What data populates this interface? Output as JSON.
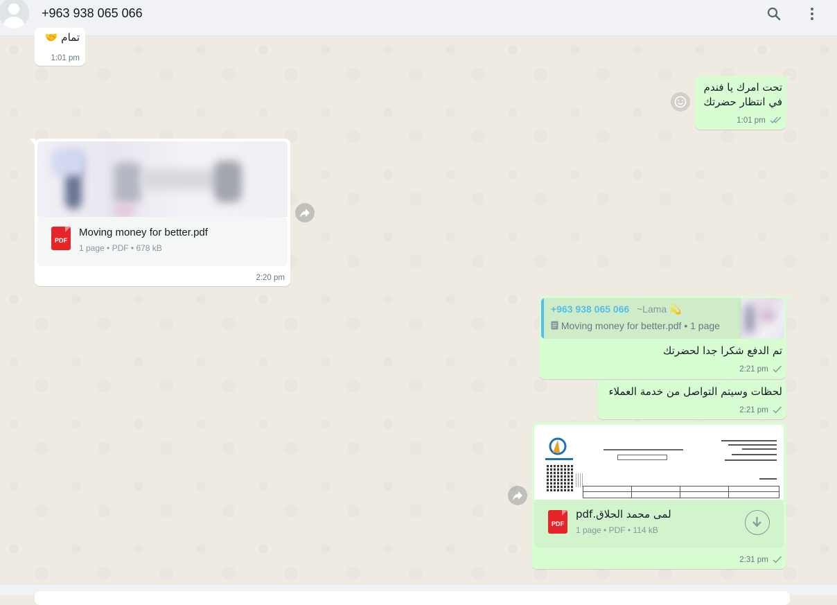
{
  "header": {
    "contact_name": "+963 938 065 066",
    "icons": [
      "search-icon",
      "menu-dots-icon"
    ]
  },
  "messages": [
    {
      "id": "m1",
      "direction": "incoming",
      "text": "تمام 🤝",
      "time": "1:01 pm"
    },
    {
      "id": "m2",
      "direction": "outgoing",
      "text_line1": "تحت امرك يا فندم",
      "text_line2": "في انتظار حضرتك",
      "time": "1:01 pm",
      "status": "read"
    },
    {
      "id": "m3",
      "direction": "incoming",
      "document": {
        "name": "Moving money for better.pdf",
        "icon_label": "PDF",
        "meta": [
          "1 page",
          "PDF",
          "678 kB"
        ]
      },
      "time": "2:20 pm"
    },
    {
      "id": "m4",
      "direction": "outgoing",
      "quote": {
        "sender": "+963 938 065 066",
        "sender_alias": "~Lama 💫",
        "text": "Moving money for better.pdf • 1 page"
      },
      "text": "تم الدفع شكرا جدا لحضرتك",
      "time": "2:21 pm",
      "status": "sent"
    },
    {
      "id": "m5",
      "direction": "outgoing",
      "text": "لحظات وسيتم التواصل من خدمة العملاء",
      "time": "2:21 pm",
      "status": "sent"
    },
    {
      "id": "m6",
      "direction": "outgoing",
      "document": {
        "name": "لمى محمد الحلاق.pdf",
        "icon_label": "PDF",
        "meta": [
          "1 page",
          "PDF",
          "114 kB"
        ]
      },
      "time": "2:31 pm",
      "status": "sent"
    }
  ],
  "colors": {
    "chat_bg": "#efeae2",
    "incoming_bubble": "#ffffff",
    "outgoing_bubble": "#d9fdd3",
    "quote_accent": "#53bdeb",
    "quote_sender": "#35cd96",
    "pdf_red": "#e5252a",
    "read_tick": "#53bdeb"
  }
}
